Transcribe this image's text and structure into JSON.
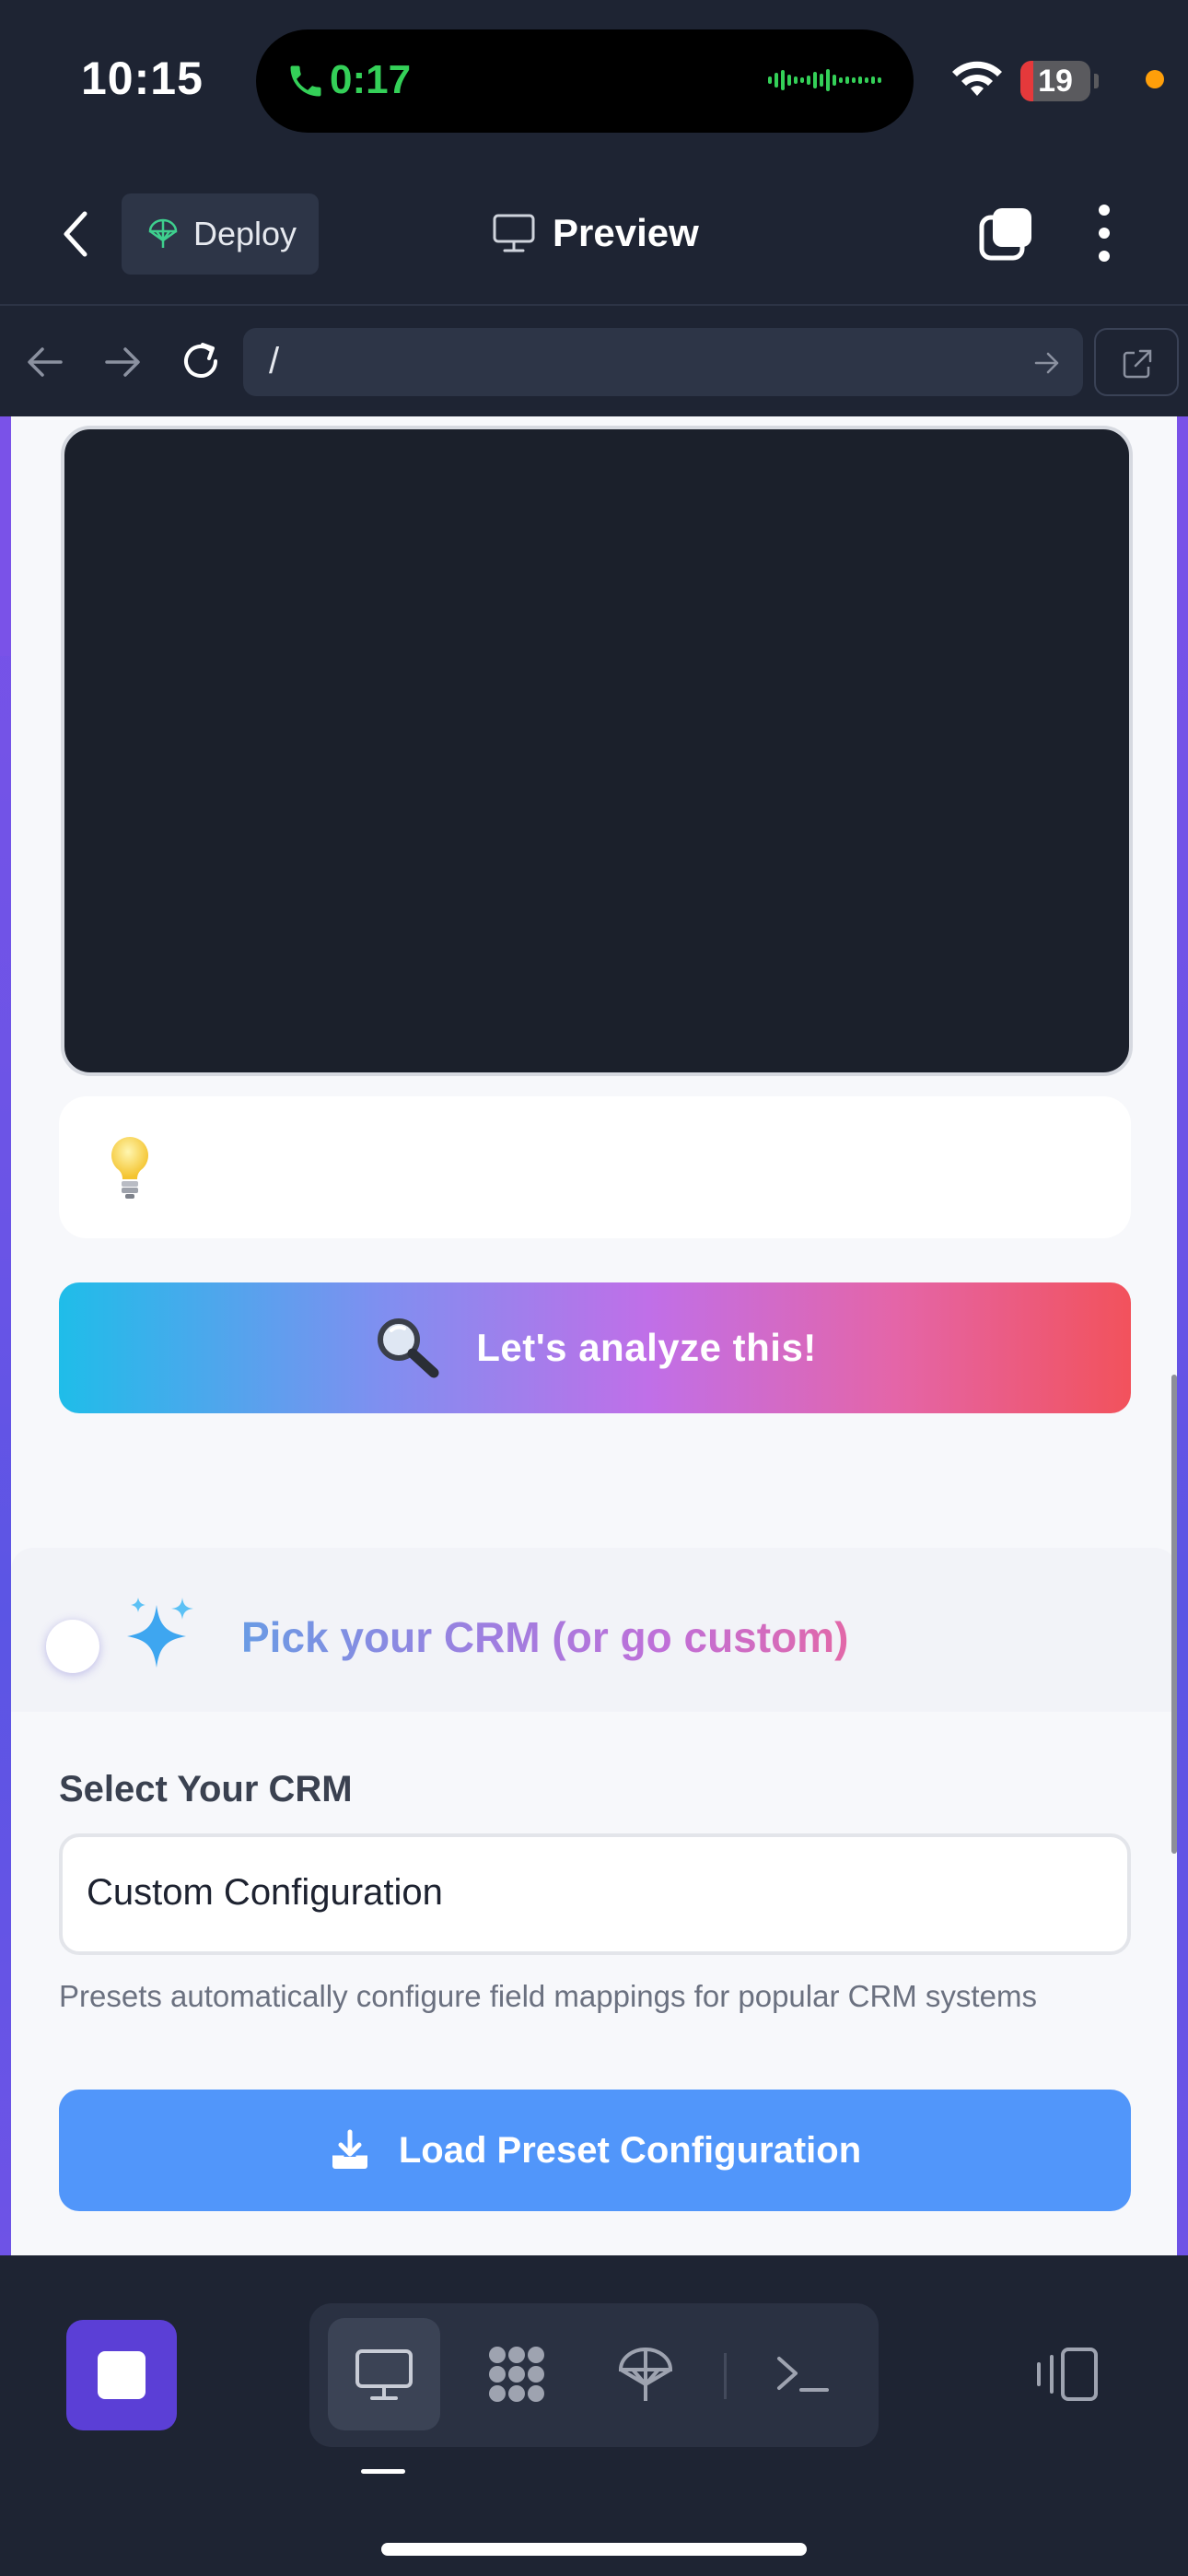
{
  "status_bar": {
    "time": "10:15",
    "call_timer": "0:17",
    "battery_level": "19",
    "colors": {
      "call_green": "#34d058",
      "battery_low": "#e5393b",
      "privacy_dot": "#ff9f0a"
    }
  },
  "header": {
    "deploy_label": "Deploy",
    "title": "Preview"
  },
  "url_bar": {
    "url": "/"
  },
  "main": {
    "tip_icon": "lightbulb-icon",
    "analyze_button": {
      "icon": "magnifier-icon",
      "label": "Let's analyze this!"
    },
    "crm_section": {
      "icon": "sparkles-icon",
      "title": "Pick your CRM (or go custom)",
      "select_label": "Select Your CRM",
      "select_value": "Custom Configuration",
      "helper_text": "Presets automatically configure field mappings for popular CRM systems",
      "load_button_label": "Load Preset Configuration"
    }
  },
  "bottom_toolbar": {
    "items": [
      "desktop-icon",
      "grid-icon",
      "deploy-icon",
      "terminal-icon"
    ],
    "active": "desktop-icon"
  },
  "theme": {
    "accent_purple": "#5b3fd6",
    "background_gradient": [
      "#7a52e8",
      "#5b55e4"
    ],
    "button_blue": "#5196fa"
  }
}
